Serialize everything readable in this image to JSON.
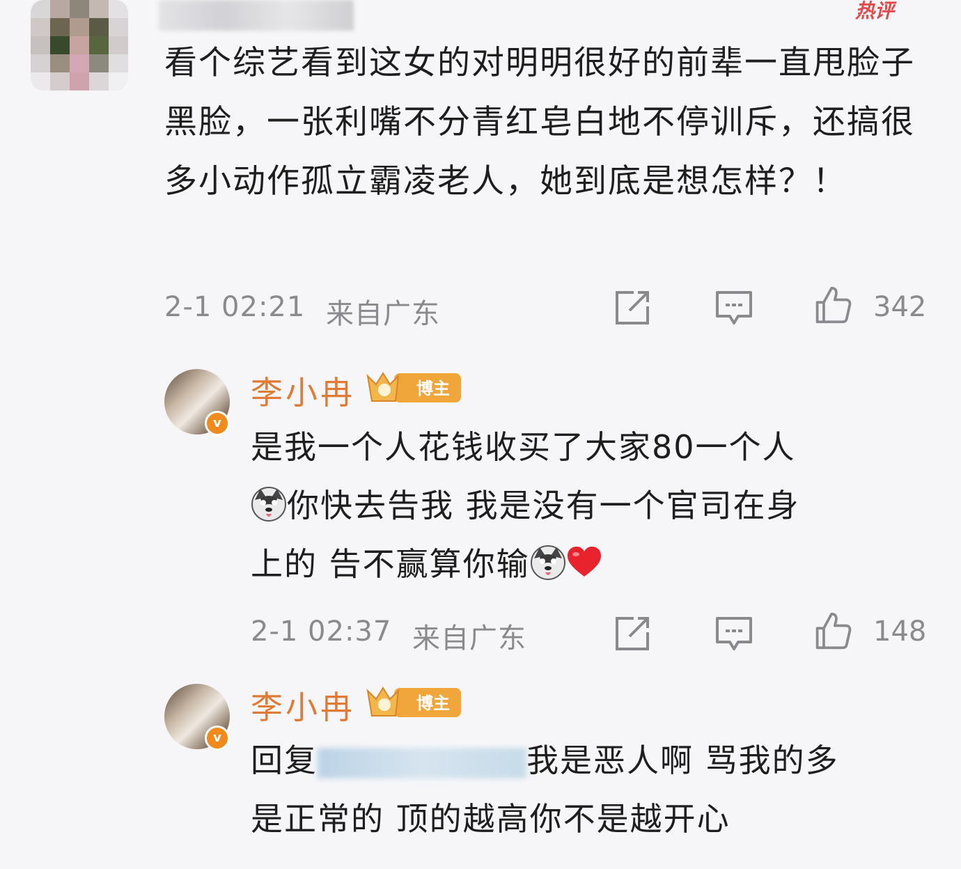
{
  "top_comment": {
    "hot_label": "热评",
    "text": "看个综艺看到这女的对明明很好的前辈一直甩脸子黑脸，一张利嘴不分青红皂白地不停训斥，还搞很多小动作孤立霸凌老人，她到底是想怎样？！",
    "time": "2-1 02:21",
    "location": "来自广东",
    "likes": "342"
  },
  "replies": [
    {
      "name": "李小冉",
      "badge": "博主",
      "text_line1": "是我一个人花钱收买了大家80一个人",
      "text_line2": "你快去告我 我是没有一个官司在身",
      "text_line3a": "上的 告不赢算你输",
      "time": "2-1 02:37",
      "location": "来自广东",
      "likes": "148"
    },
    {
      "name": "李小冉",
      "badge": "博主",
      "reply_prefix": "回复",
      "text_line1_rest": "我是恶人啊 骂我的多",
      "text_line2": "是正常的 顶的越高你不是越开心"
    }
  ],
  "icons": {
    "repost": "repost-icon",
    "comment": "comment-icon",
    "like": "thumbs-up-icon",
    "verified": "verified-v-icon",
    "emoji_dog": "husky-emoji-icon",
    "heart": "red-heart-icon"
  },
  "colors": {
    "background": "#f6f6f8",
    "name": "#e07b36",
    "meta": "#8a8a8e",
    "hot": "#e04a4a",
    "badge": "#f0a63a"
  }
}
